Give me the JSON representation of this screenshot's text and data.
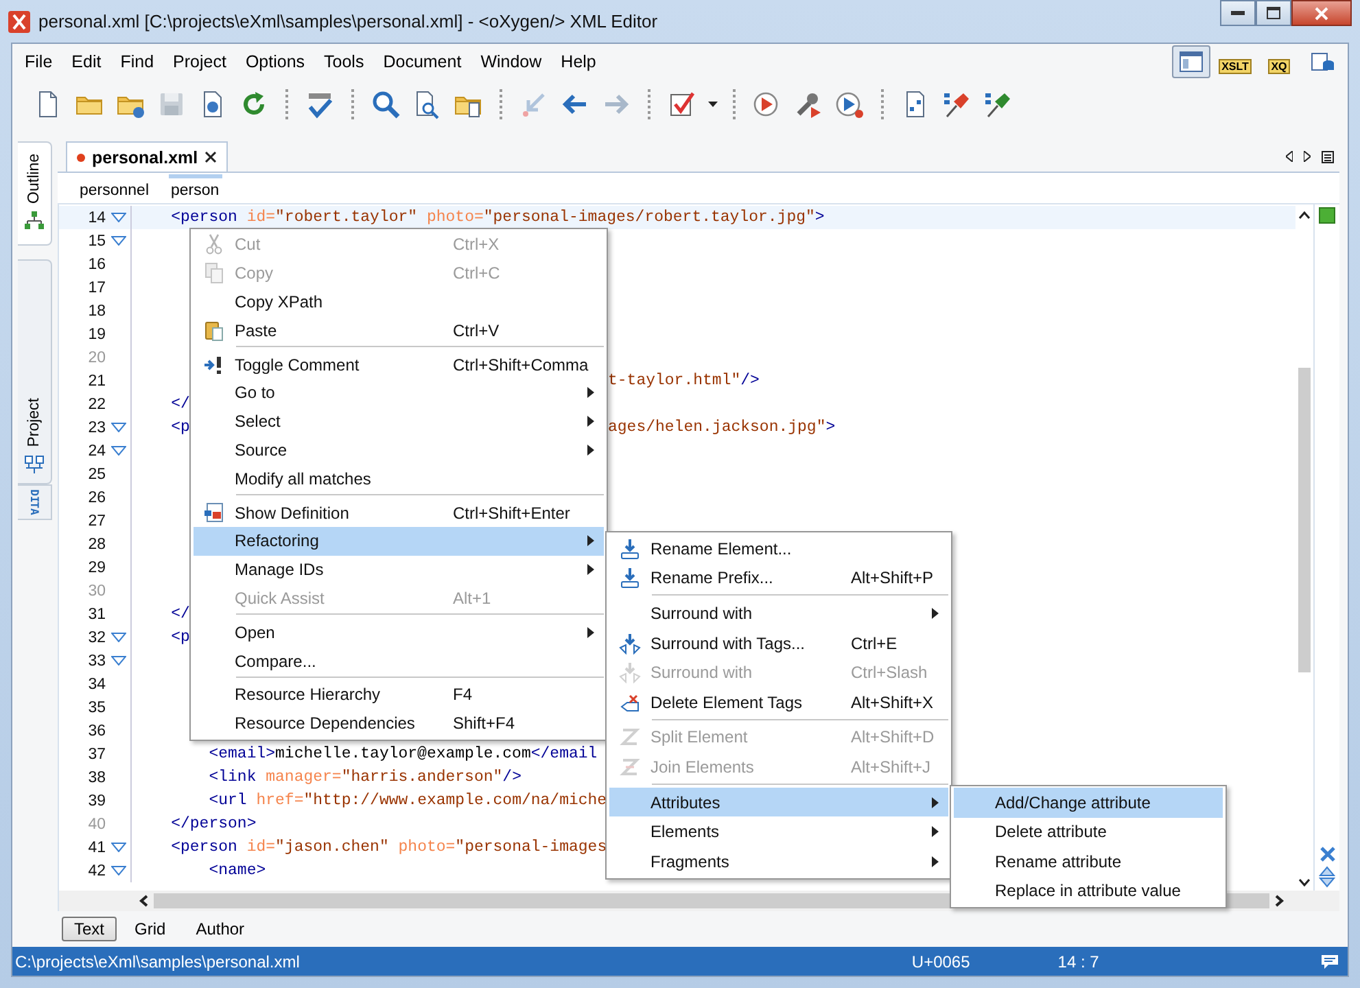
{
  "window": {
    "title": "personal.xml [C:\\projects\\eXml\\samples\\personal.xml] - <oXygen/> XML Editor"
  },
  "menu_bar": [
    "File",
    "Edit",
    "Find",
    "Project",
    "Options",
    "Tools",
    "Document",
    "Window",
    "Help"
  ],
  "perspectives": [
    {
      "kind": "editor",
      "selected": true
    },
    {
      "kind": "xslt",
      "label": "XSLT",
      "selected": false
    },
    {
      "kind": "xquery",
      "label": "XQ",
      "selected": false
    },
    {
      "kind": "database",
      "selected": false
    }
  ],
  "toolbar": [
    {
      "kind": "button",
      "disabled": false
    },
    {
      "kind": "button",
      "disabled": false
    },
    {
      "kind": "button",
      "disabled": false
    },
    {
      "kind": "button",
      "disabled": true
    },
    {
      "kind": "button",
      "disabled": false
    },
    {
      "kind": "button",
      "disabled": false
    },
    {
      "kind": "separator"
    },
    {
      "kind": "button",
      "disabled": false
    },
    {
      "kind": "separator"
    },
    {
      "kind": "button",
      "disabled": false
    },
    {
      "kind": "button",
      "disabled": false
    },
    {
      "kind": "button",
      "disabled": false
    },
    {
      "kind": "separator"
    },
    {
      "kind": "button",
      "disabled": true
    },
    {
      "kind": "button",
      "disabled": false
    },
    {
      "kind": "button",
      "disabled": true
    },
    {
      "kind": "separator"
    },
    {
      "kind": "button",
      "disabled": false
    },
    {
      "kind": "dropdown"
    },
    {
      "kind": "separator"
    },
    {
      "kind": "button",
      "disabled": false
    },
    {
      "kind": "button",
      "disabled": false
    },
    {
      "kind": "button",
      "disabled": false
    },
    {
      "kind": "separator"
    },
    {
      "kind": "button",
      "disabled": false
    },
    {
      "kind": "button",
      "disabled": false
    },
    {
      "kind": "button",
      "disabled": false
    }
  ],
  "side_tabs": [
    {
      "label": "Outline",
      "selected": true
    },
    {
      "label": "Project",
      "selected": false
    }
  ],
  "dita_button": {
    "lines": [
      "DI",
      "TA"
    ]
  },
  "editor": {
    "tabs": [
      {
        "label": "personal.xml",
        "modified": true,
        "selected": true
      }
    ],
    "breadcrumb": [
      {
        "label": "personnel",
        "selected": false
      },
      {
        "label": "person",
        "selected": true
      }
    ],
    "lines": [
      {
        "number": "14",
        "fold": true,
        "dim": false,
        "current": true,
        "code": [
          {
            "kind": "tag",
            "text": "    <person"
          },
          {
            "kind": "attr",
            "text": " id="
          },
          {
            "kind": "value",
            "text": "\"robert.taylor\""
          },
          {
            "kind": "attr",
            "text": " photo="
          },
          {
            "kind": "value",
            "text": "\"personal-images/robert.taylor.jpg\""
          },
          {
            "kind": "tag",
            "text": ">"
          }
        ]
      },
      {
        "number": "15",
        "fold": true,
        "dim": false,
        "current": false
      },
      {
        "number": "16",
        "fold": false,
        "dim": false,
        "current": false
      },
      {
        "number": "17",
        "fold": false,
        "dim": false,
        "current": false
      },
      {
        "number": "18",
        "fold": false,
        "dim": false,
        "current": false
      },
      {
        "number": "19",
        "fold": false,
        "dim": false,
        "current": false
      },
      {
        "number": "20",
        "fold": false,
        "dim": true,
        "current": false
      },
      {
        "number": "21",
        "fold": false,
        "dim": false,
        "current": false,
        "tail": [
          {
            "kind": "value",
            "text": "t-taylor.html\""
          },
          {
            "kind": "tag",
            "text": "/>"
          }
        ]
      },
      {
        "number": "22",
        "fold": false,
        "dim": false,
        "current": false,
        "code": [
          {
            "kind": "tag",
            "text": "    </"
          }
        ]
      },
      {
        "number": "23",
        "fold": true,
        "dim": false,
        "current": false,
        "code": [
          {
            "kind": "tag",
            "text": "    <p"
          }
        ],
        "tail": [
          {
            "kind": "value",
            "text": "ages/helen.jackson.jpg\""
          },
          {
            "kind": "tag",
            "text": ">"
          }
        ]
      },
      {
        "number": "24",
        "fold": true,
        "dim": false,
        "current": false
      },
      {
        "number": "25",
        "fold": false,
        "dim": false,
        "current": false
      },
      {
        "number": "26",
        "fold": false,
        "dim": false,
        "current": false
      },
      {
        "number": "27",
        "fold": false,
        "dim": false,
        "current": false
      },
      {
        "number": "28",
        "fold": false,
        "dim": false,
        "current": false
      },
      {
        "number": "29",
        "fold": false,
        "dim": false,
        "current": false
      },
      {
        "number": "30",
        "fold": false,
        "dim": true,
        "current": false
      },
      {
        "number": "31",
        "fold": false,
        "dim": false,
        "current": false,
        "code": [
          {
            "kind": "tag",
            "text": "    </"
          }
        ]
      },
      {
        "number": "32",
        "fold": true,
        "dim": false,
        "current": false,
        "code": [
          {
            "kind": "tag",
            "text": "    <p"
          }
        ]
      },
      {
        "number": "33",
        "fold": true,
        "dim": false,
        "current": false
      },
      {
        "number": "34",
        "fold": false,
        "dim": false,
        "current": false
      },
      {
        "number": "35",
        "fold": false,
        "dim": false,
        "current": false
      },
      {
        "number": "36",
        "fold": false,
        "dim": false,
        "current": false
      },
      {
        "number": "37",
        "fold": false,
        "dim": false,
        "current": false,
        "code": [
          {
            "kind": "tag",
            "text": "        <email>"
          },
          {
            "kind": "text",
            "text": "michelle.taylor@example.com"
          },
          {
            "kind": "tag",
            "text": "</email"
          }
        ]
      },
      {
        "number": "38",
        "fold": false,
        "dim": false,
        "current": false,
        "code": [
          {
            "kind": "tag",
            "text": "        <link"
          },
          {
            "kind": "attr",
            "text": " manager="
          },
          {
            "kind": "value",
            "text": "\"harris.anderson\""
          },
          {
            "kind": "tag",
            "text": "/>"
          }
        ]
      },
      {
        "number": "39",
        "fold": false,
        "dim": false,
        "current": false,
        "code": [
          {
            "kind": "tag",
            "text": "        <url"
          },
          {
            "kind": "attr",
            "text": " href="
          },
          {
            "kind": "value",
            "text": "\"http://www.example.com/na/miche"
          }
        ]
      },
      {
        "number": "40",
        "fold": false,
        "dim": true,
        "current": false,
        "code": [
          {
            "kind": "tag",
            "text": "    </person>"
          }
        ]
      },
      {
        "number": "41",
        "fold": true,
        "dim": false,
        "current": false,
        "code": [
          {
            "kind": "tag",
            "text": "    <person"
          },
          {
            "kind": "attr",
            "text": " id="
          },
          {
            "kind": "value",
            "text": "\"jason.chen\""
          },
          {
            "kind": "attr",
            "text": " photo="
          },
          {
            "kind": "value",
            "text": "\"personal-images"
          }
        ]
      },
      {
        "number": "42",
        "fold": true,
        "dim": false,
        "current": false,
        "code": [
          {
            "kind": "tag",
            "text": "        <name>"
          }
        ]
      }
    ],
    "mode_tabs": [
      {
        "label": "Text",
        "selected": true
      },
      {
        "label": "Grid",
        "selected": false
      },
      {
        "label": "Author",
        "selected": false
      }
    ]
  },
  "context_menu": {
    "items": [
      {
        "kind": "item",
        "label": "Cut",
        "shortcut": "Ctrl+X",
        "disabled": true,
        "selected": false,
        "has_submenu": false
      },
      {
        "kind": "item",
        "label": "Copy",
        "shortcut": "Ctrl+C",
        "disabled": true,
        "selected": false,
        "has_submenu": false
      },
      {
        "kind": "item",
        "label": "Copy XPath",
        "disabled": false,
        "selected": false,
        "has_submenu": false
      },
      {
        "kind": "item",
        "label": "Paste",
        "shortcut": "Ctrl+V",
        "disabled": false,
        "selected": false,
        "has_submenu": false
      },
      {
        "kind": "separator"
      },
      {
        "kind": "item",
        "label": "Toggle Comment",
        "shortcut": "Ctrl+Shift+Comma",
        "disabled": false,
        "selected": false,
        "has_submenu": false
      },
      {
        "kind": "item",
        "label": "Go to",
        "disabled": false,
        "selected": false,
        "has_submenu": true
      },
      {
        "kind": "item",
        "label": "Select",
        "disabled": false,
        "selected": false,
        "has_submenu": true
      },
      {
        "kind": "item",
        "label": "Source",
        "disabled": false,
        "selected": false,
        "has_submenu": true
      },
      {
        "kind": "item",
        "label": "Modify all matches",
        "disabled": false,
        "selected": false,
        "has_submenu": false
      },
      {
        "kind": "separator"
      },
      {
        "kind": "item",
        "label": "Show Definition",
        "shortcut": "Ctrl+Shift+Enter",
        "disabled": false,
        "selected": false,
        "has_submenu": false
      },
      {
        "kind": "item",
        "label": "Refactoring",
        "disabled": false,
        "selected": true,
        "has_submenu": true,
        "submenu": [
          {
            "kind": "item",
            "label": "Rename Element...",
            "disabled": false,
            "selected": false,
            "has_submenu": false
          },
          {
            "kind": "item",
            "label": "Rename Prefix...",
            "shortcut": "Alt+Shift+P",
            "disabled": false,
            "selected": false,
            "has_submenu": false
          },
          {
            "kind": "separator"
          },
          {
            "kind": "item",
            "label": "Surround with",
            "disabled": false,
            "selected": false,
            "has_submenu": true
          },
          {
            "kind": "item",
            "label": "Surround with Tags...",
            "shortcut": "Ctrl+E",
            "disabled": false,
            "selected": false,
            "has_submenu": false
          },
          {
            "kind": "item",
            "label": "Surround with",
            "shortcut": "Ctrl+Slash",
            "disabled": true,
            "selected": false,
            "has_submenu": false
          },
          {
            "kind": "item",
            "label": "Delete Element Tags",
            "shortcut": "Alt+Shift+X",
            "disabled": false,
            "selected": false,
            "has_submenu": false
          },
          {
            "kind": "separator"
          },
          {
            "kind": "item",
            "label": "Split Element",
            "shortcut": "Alt+Shift+D",
            "disabled": true,
            "selected": false,
            "has_submenu": false
          },
          {
            "kind": "item",
            "label": "Join Elements",
            "shortcut": "Alt+Shift+J",
            "disabled": true,
            "selected": false,
            "has_submenu": false
          },
          {
            "kind": "separator"
          },
          {
            "kind": "item",
            "label": "Attributes",
            "disabled": false,
            "selected": true,
            "has_submenu": true,
            "submenu": [
              {
                "kind": "item",
                "label": "Add/Change attribute",
                "disabled": false,
                "selected": true,
                "has_submenu": false
              },
              {
                "kind": "item",
                "label": "Delete attribute",
                "disabled": false,
                "selected": false,
                "has_submenu": false
              },
              {
                "kind": "item",
                "label": "Rename attribute",
                "disabled": false,
                "selected": false,
                "has_submenu": false
              },
              {
                "kind": "item",
                "label": "Replace in attribute value",
                "disabled": false,
                "selected": false,
                "has_submenu": false
              }
            ]
          },
          {
            "kind": "item",
            "label": "Elements",
            "disabled": false,
            "selected": false,
            "has_submenu": true
          },
          {
            "kind": "item",
            "label": "Fragments",
            "disabled": false,
            "selected": false,
            "has_submenu": true
          }
        ]
      },
      {
        "kind": "item",
        "label": "Manage IDs",
        "disabled": false,
        "selected": false,
        "has_submenu": true
      },
      {
        "kind": "item",
        "label": "Quick Assist",
        "shortcut": "Alt+1",
        "disabled": true,
        "selected": false,
        "has_submenu": false
      },
      {
        "kind": "separator"
      },
      {
        "kind": "item",
        "label": "Open",
        "disabled": false,
        "selected": false,
        "has_submenu": true
      },
      {
        "kind": "item",
        "label": "Compare...",
        "disabled": false,
        "selected": false,
        "has_submenu": false
      },
      {
        "kind": "separator"
      },
      {
        "kind": "item",
        "label": "Resource Hierarchy",
        "shortcut": "F4",
        "disabled": false,
        "selected": false,
        "has_submenu": false
      },
      {
        "kind": "item",
        "label": "Resource Dependencies",
        "shortcut": "Shift+F4",
        "disabled": false,
        "selected": false,
        "has_submenu": false
      }
    ]
  },
  "status_bar": {
    "path": "C:\\projects\\eXml\\samples\\personal.xml",
    "encoding": "U+0065",
    "position": "14 : 7"
  }
}
